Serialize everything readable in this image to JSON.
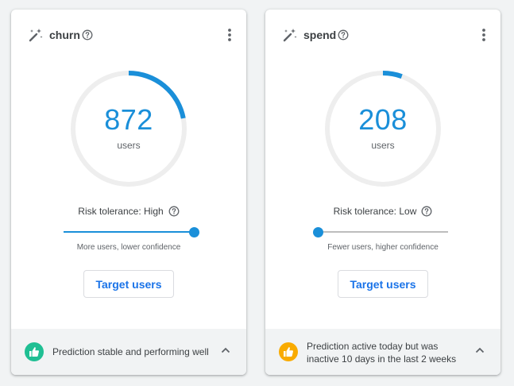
{
  "cards": [
    {
      "title": "churn",
      "count": "872",
      "count_fraction": 0.22,
      "unit": "users",
      "risk_label": "Risk tolerance: High",
      "slider_position": 1.0,
      "slider_caption": "More users, lower confidence",
      "button_label": "Target users",
      "status_text": "Prediction stable and performing well",
      "status_color": "#1fbf93",
      "status_icon": "thumbs-up-icon"
    },
    {
      "title": "spend",
      "count": "208",
      "count_fraction": 0.055,
      "unit": "users",
      "risk_label": "Risk tolerance: Low",
      "slider_position": 0.0,
      "slider_caption": "Fewer users, higher confidence",
      "button_label": "Target users",
      "status_text": "Prediction active today but was inactive 10 days in the last 2 weeks",
      "status_color": "#f9ab00",
      "status_icon": "thumbs-up-icon"
    }
  ],
  "colors": {
    "accent": "#1a8fd9",
    "button_text": "#1a73e8",
    "gauge_track": "#eeeeee"
  }
}
